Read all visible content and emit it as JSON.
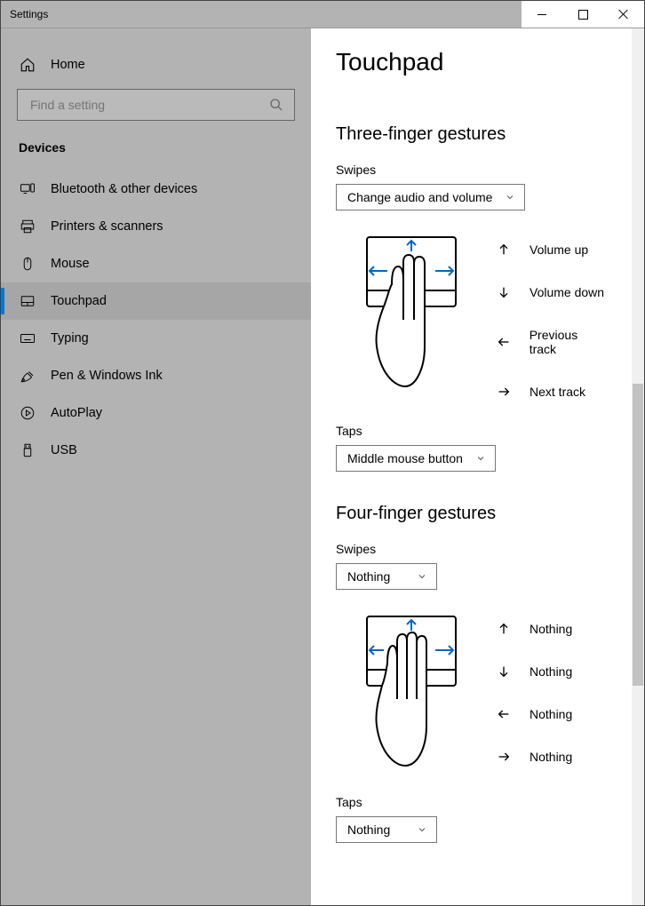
{
  "window": {
    "title": "Settings"
  },
  "sidebar": {
    "home": "Home",
    "search_placeholder": "Find a setting",
    "section": "Devices",
    "items": [
      {
        "label": "Bluetooth & other devices"
      },
      {
        "label": "Printers & scanners"
      },
      {
        "label": "Mouse"
      },
      {
        "label": "Touchpad"
      },
      {
        "label": "Typing"
      },
      {
        "label": "Pen & Windows Ink"
      },
      {
        "label": "AutoPlay"
      },
      {
        "label": "USB"
      }
    ]
  },
  "page": {
    "title": "Touchpad",
    "three": {
      "heading": "Three-finger gestures",
      "swipes_label": "Swipes",
      "swipes_value": "Change audio and volume",
      "legend": {
        "up": "Volume up",
        "down": "Volume down",
        "left": "Previous track",
        "right": "Next track"
      },
      "taps_label": "Taps",
      "taps_value": "Middle mouse button"
    },
    "four": {
      "heading": "Four-finger gestures",
      "swipes_label": "Swipes",
      "swipes_value": "Nothing",
      "legend": {
        "up": "Nothing",
        "down": "Nothing",
        "left": "Nothing",
        "right": "Nothing"
      },
      "taps_label": "Taps",
      "taps_value": "Nothing"
    }
  }
}
